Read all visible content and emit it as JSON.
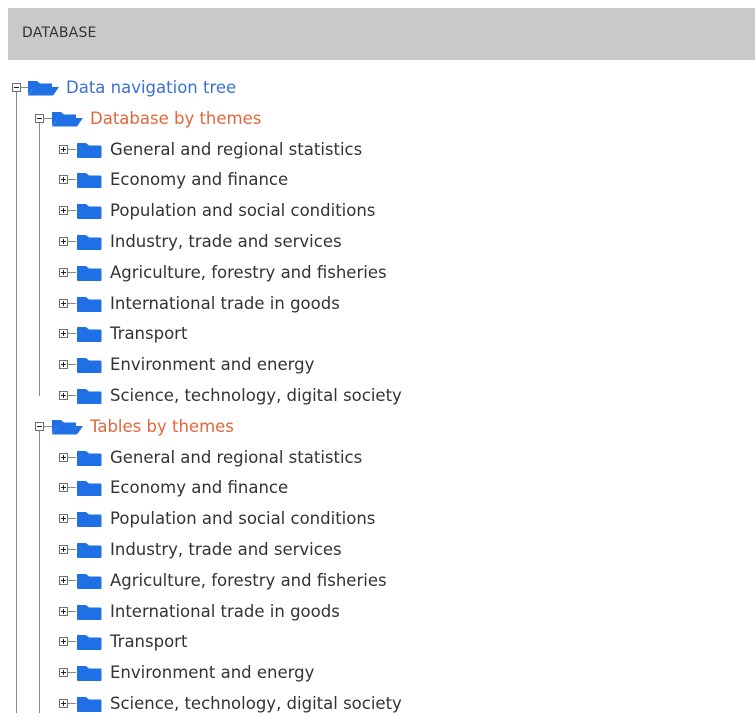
{
  "header": {
    "title": "DATABASE"
  },
  "colors": {
    "header_bg": "#c9c9c9",
    "root_link": "#3a6fd8",
    "section_link": "#e4653b",
    "item_text": "#333333",
    "folder_blue": "#1f6fe5"
  },
  "tree": {
    "root": {
      "label": "Data navigation tree",
      "icon": "folder-open-icon",
      "state": "expanded"
    },
    "sections": [
      {
        "label": "Database by themes",
        "icon": "folder-open-icon",
        "state": "expanded",
        "items": [
          {
            "label": "General and regional statistics",
            "icon": "folder-icon",
            "state": "collapsed"
          },
          {
            "label": "Economy and finance",
            "icon": "folder-icon",
            "state": "collapsed"
          },
          {
            "label": "Population and social conditions",
            "icon": "folder-icon",
            "state": "collapsed"
          },
          {
            "label": "Industry, trade and services",
            "icon": "folder-icon",
            "state": "collapsed"
          },
          {
            "label": "Agriculture, forestry and fisheries",
            "icon": "folder-icon",
            "state": "collapsed"
          },
          {
            "label": "International trade in goods",
            "icon": "folder-icon",
            "state": "collapsed"
          },
          {
            "label": "Transport",
            "icon": "folder-icon",
            "state": "collapsed"
          },
          {
            "label": "Environment and energy",
            "icon": "folder-icon",
            "state": "collapsed"
          },
          {
            "label": "Science, technology, digital society",
            "icon": "folder-icon",
            "state": "collapsed"
          }
        ]
      },
      {
        "label": "Tables by themes",
        "icon": "folder-open-icon",
        "state": "expanded",
        "items": [
          {
            "label": "General and regional statistics",
            "icon": "folder-icon",
            "state": "collapsed"
          },
          {
            "label": "Economy and finance",
            "icon": "folder-icon",
            "state": "collapsed"
          },
          {
            "label": "Population and social conditions",
            "icon": "folder-icon",
            "state": "collapsed"
          },
          {
            "label": "Industry, trade and services",
            "icon": "folder-icon",
            "state": "collapsed"
          },
          {
            "label": "Agriculture, forestry and fisheries",
            "icon": "folder-icon",
            "state": "collapsed"
          },
          {
            "label": "International trade in goods",
            "icon": "folder-icon",
            "state": "collapsed"
          },
          {
            "label": "Transport",
            "icon": "folder-icon",
            "state": "collapsed"
          },
          {
            "label": "Environment and energy",
            "icon": "folder-icon",
            "state": "collapsed"
          },
          {
            "label": "Science, technology, digital society",
            "icon": "folder-icon",
            "state": "collapsed"
          }
        ]
      }
    ]
  }
}
